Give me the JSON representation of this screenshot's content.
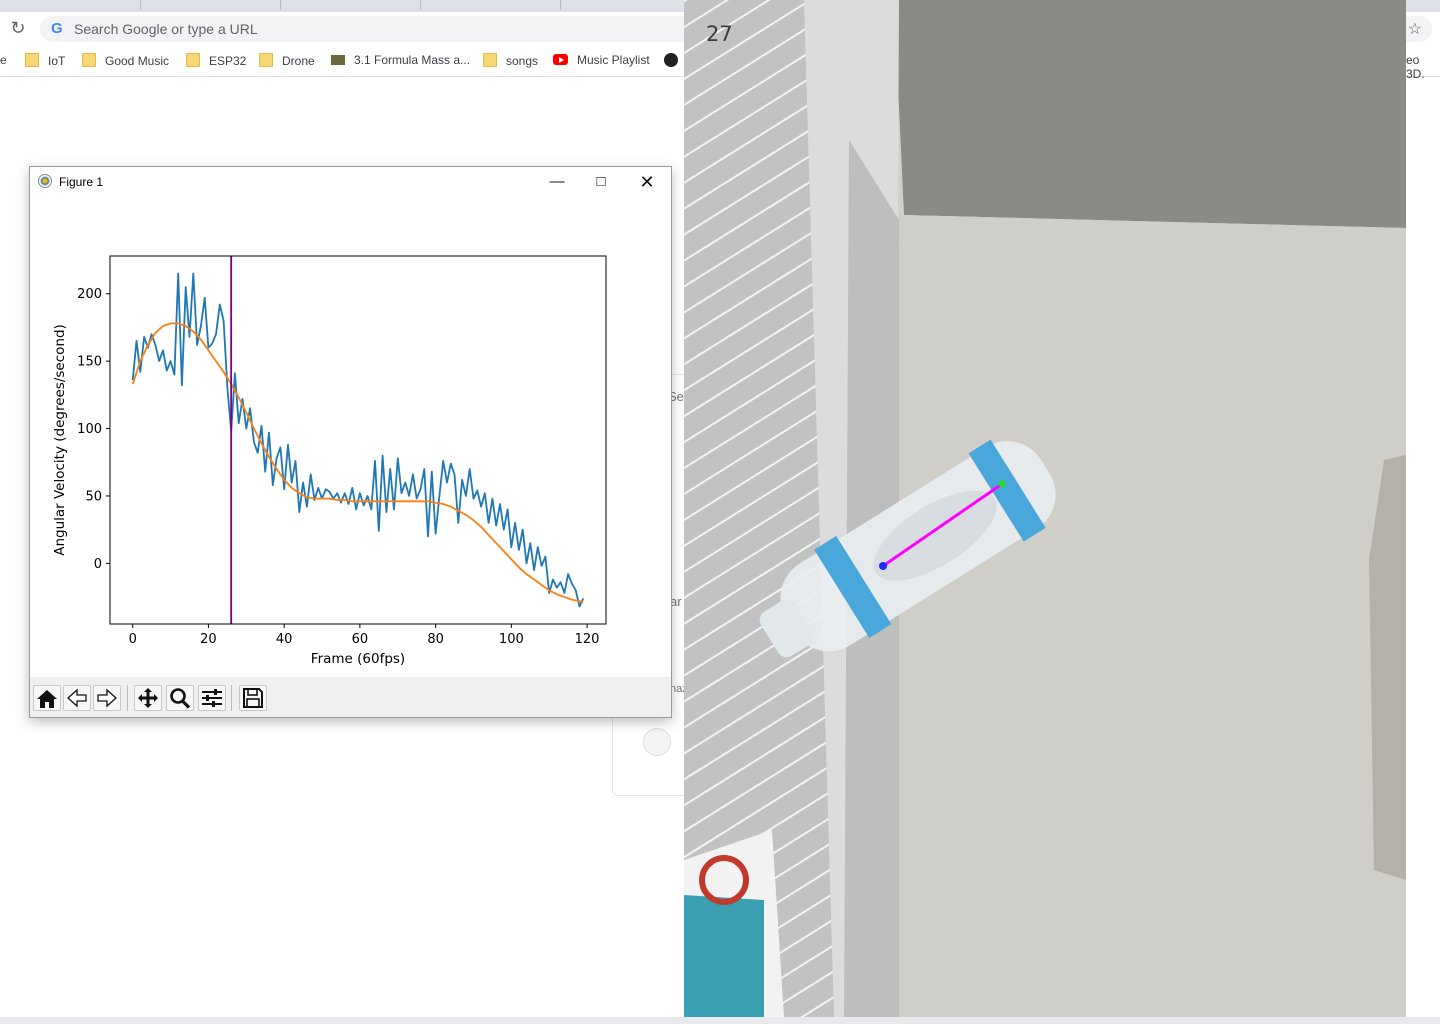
{
  "browser": {
    "omnibox_placeholder": "Search Google or type a URL",
    "bookmarks": [
      {
        "label": "e",
        "icon": "folder-icon"
      },
      {
        "label": "IoT",
        "icon": "folder-icon"
      },
      {
        "label": "Good Music",
        "icon": "folder-icon"
      },
      {
        "label": "ESP32",
        "icon": "folder-icon"
      },
      {
        "label": "Drone",
        "icon": "folder-icon"
      },
      {
        "label": "3.1 Formula Mass a...",
        "icon": "book-icon"
      },
      {
        "label": "songs",
        "icon": "folder-icon"
      },
      {
        "label": "Music Playlist",
        "icon": "youtube-icon"
      }
    ],
    "bookmark_overflow": "eo 3D."
  },
  "page_fragments": {
    "a": "Sea",
    "b": "ar",
    "c": "naz"
  },
  "figure": {
    "title": "Figure 1",
    "toolbar": [
      "home",
      "back",
      "forward",
      "pan",
      "zoom",
      "configure",
      "save"
    ]
  },
  "video": {
    "frame_number": "27"
  },
  "chart_data": {
    "type": "line",
    "xlabel": "Frame (60fps)",
    "ylabel": "Angular Velocity (degrees/second)",
    "xlim": [
      -6,
      125
    ],
    "ylim": [
      -45,
      228
    ],
    "xticks": [
      0,
      20,
      40,
      60,
      80,
      100,
      120
    ],
    "yticks": [
      0,
      50,
      100,
      150,
      200
    ],
    "vline_x": 26,
    "vline_color": "#800080",
    "series": [
      {
        "color": "#1f77b4",
        "x": [
          0,
          1,
          2,
          3,
          4,
          5,
          6,
          7,
          8,
          9,
          10,
          11,
          12,
          13,
          14,
          15,
          16,
          17,
          18,
          19,
          20,
          21,
          22,
          23,
          24,
          25,
          26,
          27,
          28,
          29,
          30,
          31,
          32,
          33,
          34,
          35,
          36,
          37,
          38,
          39,
          40,
          41,
          42,
          43,
          44,
          45,
          46,
          47,
          48,
          49,
          50,
          51,
          52,
          53,
          54,
          55,
          56,
          57,
          58,
          59,
          60,
          61,
          62,
          63,
          64,
          65,
          66,
          67,
          68,
          69,
          70,
          71,
          72,
          73,
          74,
          75,
          76,
          77,
          78,
          79,
          80,
          81,
          82,
          83,
          84,
          85,
          86,
          87,
          88,
          89,
          90,
          91,
          92,
          93,
          94,
          95,
          96,
          97,
          98,
          99,
          100,
          101,
          102,
          103,
          104,
          105,
          106,
          107,
          108,
          109,
          110,
          111,
          112,
          113,
          114,
          115,
          116,
          117,
          118,
          119
        ],
        "y": [
          136,
          165,
          142,
          168,
          160,
          170,
          162,
          150,
          158,
          143,
          150,
          140,
          215,
          132,
          205,
          168,
          215,
          162,
          176,
          197,
          160,
          163,
          170,
          192,
          180,
          130,
          98,
          141,
          104,
          122,
          100,
          115,
          90,
          82,
          102,
          68,
          97,
          58,
          78,
          86,
          55,
          88,
          60,
          76,
          38,
          60,
          42,
          66,
          47,
          56,
          48,
          55,
          53,
          48,
          52,
          45,
          52,
          44,
          56,
          40,
          52,
          43,
          50,
          40,
          76,
          24,
          80,
          38,
          70,
          40,
          78,
          52,
          60,
          50,
          66,
          48,
          55,
          70,
          20,
          68,
          22,
          50,
          76,
          60,
          74,
          66,
          30,
          62,
          50,
          70,
          48,
          54,
          42,
          52,
          30,
          48,
          28,
          44,
          25,
          40,
          12,
          30,
          10,
          25,
          0,
          15,
          -5,
          12,
          -2,
          5,
          -22,
          -12,
          -18,
          -14,
          -22,
          -8,
          -15,
          -20,
          -32,
          -26
        ]
      },
      {
        "color": "#ff7f0e",
        "x": [
          0,
          2,
          4,
          6,
          8,
          10,
          12,
          14,
          16,
          18,
          20,
          22,
          24,
          26,
          28,
          30,
          32,
          34,
          36,
          38,
          40,
          42,
          44,
          46,
          48,
          50,
          52,
          54,
          56,
          58,
          60,
          62,
          64,
          66,
          68,
          70,
          72,
          74,
          76,
          78,
          80,
          82,
          84,
          86,
          88,
          90,
          92,
          94,
          96,
          98,
          100,
          102,
          104,
          106,
          108,
          110,
          112,
          114,
          116,
          118,
          119
        ],
        "y": [
          133,
          150,
          162,
          171,
          176,
          178,
          178,
          176,
          172,
          166,
          158,
          150,
          142,
          133,
          123,
          112,
          100,
          89,
          79,
          70,
          62,
          56,
          52,
          49,
          48,
          48,
          48,
          47,
          47,
          46,
          46,
          46,
          46,
          46,
          46,
          46,
          46,
          46,
          46,
          46,
          45,
          44,
          42,
          39,
          36,
          32,
          27,
          21,
          15,
          9,
          3,
          -3,
          -8,
          -12,
          -16,
          -20,
          -23,
          -25,
          -27,
          -28,
          -29
        ]
      }
    ]
  }
}
